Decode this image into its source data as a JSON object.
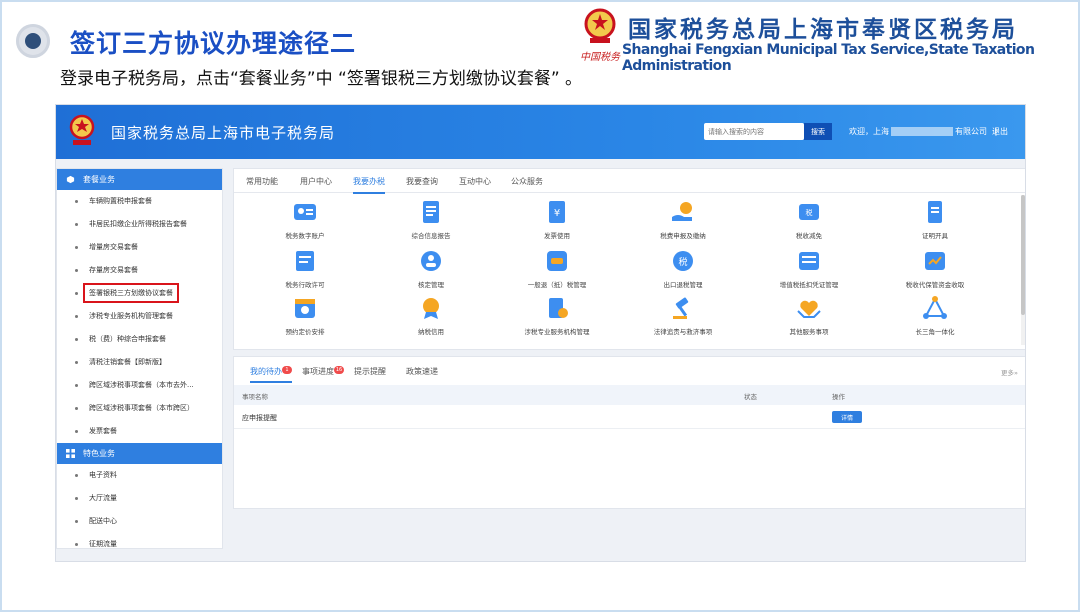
{
  "slide": {
    "title": "签订三方协议办理途径二",
    "subtitle": "登录电子税务局，点击“套餐业务”中 “签署银税三方划缴协议套餐” 。",
    "bureau_cn": "国家税务总局上海市奉贤区税务局",
    "bureau_en": "Shanghai Fengxian Municipal Tax Service,State Taxation Administration",
    "emblem_text": "中国税务"
  },
  "portal": {
    "title": "国家税务总局上海市电子税务局",
    "search_placeholder": "请输入搜索的内容",
    "search_button": "搜索",
    "greeting_prefix": "欢迎，上海",
    "greeting_suffix": "有限公司",
    "separator": "|",
    "logout": "退出"
  },
  "sidebar": {
    "section1_title": "套餐业务",
    "section1_items": [
      "车辆购置税申报套餐",
      "非居民扣缴企业所得税报告套餐",
      "增量房交易套餐",
      "存量房交易套餐",
      "签署银税三方划缴协议套餐",
      "涉税专业服务机构管理套餐",
      "税（费）种综合申报套餐",
      "清税注销套餐【即新版】",
      "跨区域涉税事项套餐（本市去外...",
      "跨区域涉税事项套餐（本市跨区）",
      "发票套餐"
    ],
    "section2_title": "特色业务",
    "section2_items": [
      "电子资料",
      "大厅流量",
      "配送中心",
      "征期流量"
    ]
  },
  "main": {
    "tabs": [
      "常用功能",
      "用户中心",
      "我要办税",
      "我要查询",
      "互动中心",
      "公众服务"
    ],
    "active_tab": "我要办税",
    "grid": [
      "税务数字账户",
      "综合信息报告",
      "发票使用",
      "税费申报及缴纳",
      "税收减免",
      "证明开具",
      "税务行政许可",
      "核定管理",
      "一般退（抵）税管理",
      "出口退税管理",
      "增值税抵扣凭证管理",
      "税收代保管资金收取",
      "预约定价安排",
      "纳税信用",
      "涉税专业服务机构管理",
      "法律追责与救济事项",
      "其他服务事项",
      "长三角一体化"
    ]
  },
  "todo": {
    "tabs": [
      "我的待办",
      "事项进度",
      "提示提醒",
      "政策速递"
    ],
    "badge1": "1",
    "badge2": "16",
    "more": "更多»",
    "columns": [
      "事项名称",
      "状态",
      "操作"
    ],
    "rows": [
      {
        "name": "应申报提醒",
        "status": "",
        "action": "详情"
      }
    ]
  },
  "colors": {
    "primary_blue": "#2f7fe0",
    "title_blue": "#1a4fc4",
    "highlight_red": "#d9141b"
  }
}
